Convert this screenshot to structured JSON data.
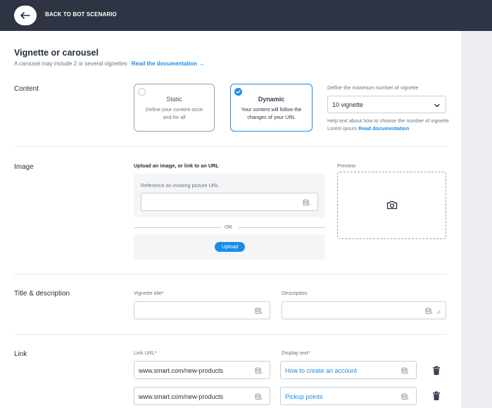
{
  "header": {
    "back_label": "BACK TO BOT SCENARIO"
  },
  "page": {
    "title": "Vignette or carousel",
    "subtitle": "A carousel may include 2 or several vignettes",
    "doc_link": "Read the documentation →"
  },
  "content": {
    "label": "Content",
    "static": {
      "title": "Static",
      "desc": "Define your content once and for all"
    },
    "dynamic": {
      "title": "Dynamic",
      "desc": "Your content will follow the changes of your URL"
    },
    "max_label": "Define the maximum number of vignette",
    "select_value": "10 vignette",
    "help_text": "Help text about how to choose the number of vignette Lorem ipsum",
    "help_link": "Read documentation"
  },
  "image": {
    "label": "Image",
    "upload_label": "Upload an image, or link to an URL",
    "reference_label": "Reference an existing picture URL",
    "or_text": "OR",
    "upload_button": "Upload",
    "preview_label": "Preview"
  },
  "title_desc": {
    "label": "Title & description",
    "vignette_title_label": "Vignette title*",
    "description_label": "Description"
  },
  "link": {
    "label": "Link",
    "url_label": "Link URL*",
    "display_label": "Display text*",
    "rows": [
      {
        "url": "www.smart.com/new-products",
        "text": "How to create an account"
      },
      {
        "url": "www.smart.com/new-products",
        "text": "Pickup points"
      }
    ]
  },
  "colors": {
    "accent": "#1a8de9",
    "topbar": "#2e3444",
    "side_panel": "#eceef1"
  }
}
